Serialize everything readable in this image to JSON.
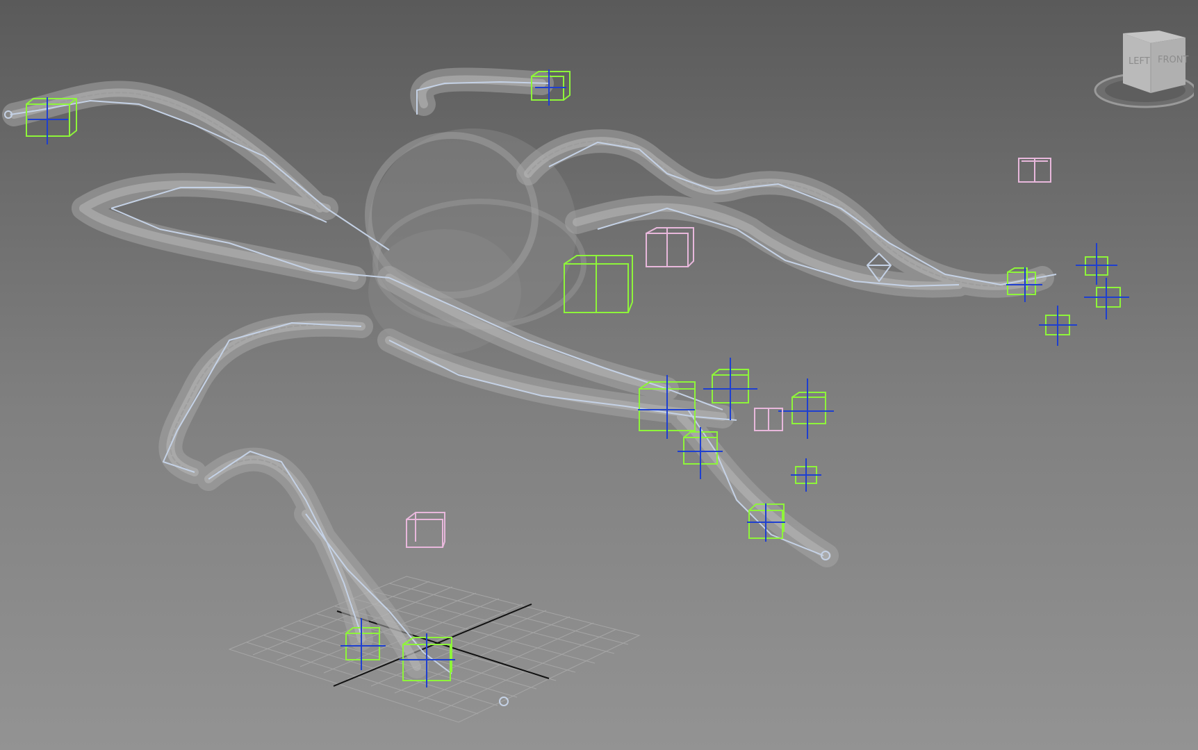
{
  "viewport": {
    "background_top": "#5a5a5a",
    "background_bottom": "#939393"
  },
  "viewcube": {
    "left_face_label": "LEFT",
    "front_face_label": "FRONT"
  },
  "colors": {
    "mesh_wireframe": "#a6a6a6",
    "bones": "#c5d2e6",
    "ik_controls": "#8ef53a",
    "helper_boxes": "#e8b8dc",
    "pivot_axes": "#1e3fd0",
    "grid": "#aeaeae",
    "world_axes": "#111111"
  },
  "icons": {
    "viewcube": "viewcube-icon",
    "point_helper": "point-helper-icon",
    "world_origin": "world-axes-icon"
  }
}
